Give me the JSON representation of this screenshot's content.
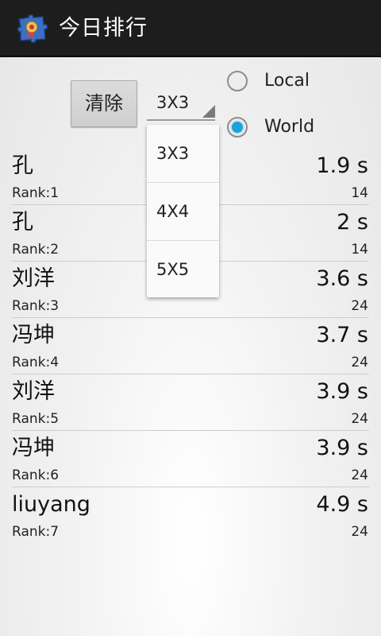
{
  "app": {
    "title": "今日排行",
    "icon": "puzzle-app-icon"
  },
  "controls": {
    "clear_label": "清除",
    "size_selected": "3X3",
    "size_options": [
      "3X3",
      "4X4",
      "5X5"
    ],
    "scope_options": [
      {
        "label": "Local",
        "checked": false
      },
      {
        "label": "World",
        "checked": true
      }
    ]
  },
  "leaderboard": [
    {
      "name": "孔",
      "time": "1.9 s",
      "rank": "Rank:1",
      "count": "14"
    },
    {
      "name": "孔",
      "time": "2 s",
      "rank": "Rank:2",
      "count": "14"
    },
    {
      "name": "刘洋",
      "time": "3.6 s",
      "rank": "Rank:3",
      "count": "24"
    },
    {
      "name": "冯坤",
      "time": "3.7 s",
      "rank": "Rank:4",
      "count": "24"
    },
    {
      "name": "刘洋",
      "time": "3.9 s",
      "rank": "Rank:5",
      "count": "24"
    },
    {
      "name": "冯坤",
      "time": "3.9 s",
      "rank": "Rank:6",
      "count": "24"
    },
    {
      "name": "liuyang",
      "time": "4.9 s",
      "rank": "Rank:7",
      "count": "24"
    }
  ],
  "colors": {
    "title_bar": "#1d1d1d",
    "radio_accent": "#1ea1d8"
  }
}
